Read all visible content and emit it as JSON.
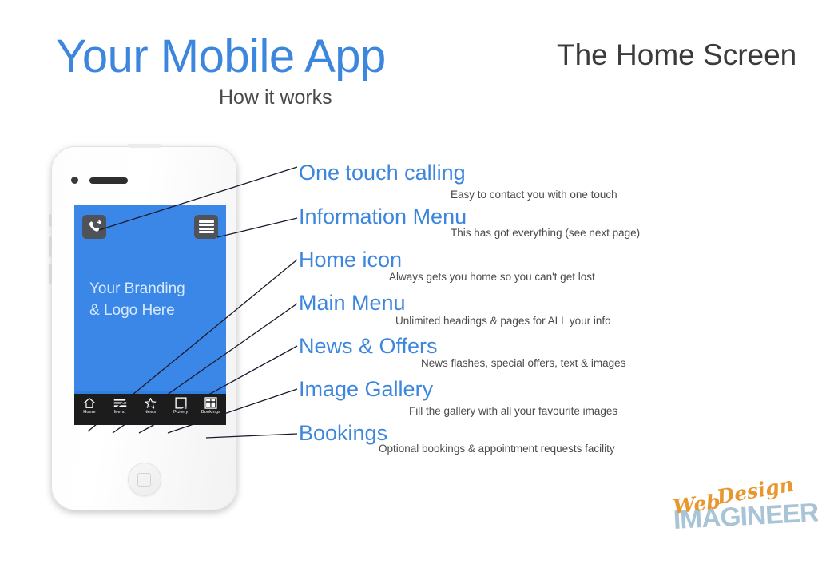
{
  "header": {
    "title": "Your Mobile App",
    "subtitle": "How it works",
    "section_title": "The Home Screen",
    "title_color": "#3d86dd",
    "subtitle_color": "#4a4a4a"
  },
  "phone": {
    "screen_color": "#3b87e8",
    "branding_line_1": "Your Branding",
    "branding_line_2": "& Logo Here",
    "topbar": {
      "call_icon": "phone-call-icon",
      "menu_icon": "hamburger-menu-icon",
      "tile_color": "#4f5359"
    },
    "nav": [
      {
        "label": "Home",
        "icon": "home-icon"
      },
      {
        "label": "Menu",
        "icon": "hamburger-menu-icon"
      },
      {
        "label": "News",
        "icon": "star-icon"
      },
      {
        "label": "Gallery",
        "icon": "square-frame-icon"
      },
      {
        "label": "Bookings",
        "icon": "calendar-grid-icon"
      }
    ]
  },
  "callouts": [
    {
      "title": "One touch calling",
      "desc": "Easy to contact you with one touch"
    },
    {
      "title": "Information Menu",
      "desc": "This has got everything (see next page)"
    },
    {
      "title": "Home icon",
      "desc": "Always gets you home so you can't get lost"
    },
    {
      "title": "Main Menu",
      "desc": "Unlimited headings & pages for ALL your info"
    },
    {
      "title": "News & Offers",
      "desc": "News flashes, special offers, text & images"
    },
    {
      "title": "Image Gallery",
      "desc": "Fill the gallery with all your favourite images"
    },
    {
      "title": "Bookings",
      "desc": "Optional bookings & appointment requests facility"
    }
  ],
  "logo": {
    "word_web": "Web",
    "word_design": "Design",
    "word_imagineers": "IMAGINEERS",
    "script_color": "#e8962e",
    "block_color": "#a8c4d6"
  }
}
